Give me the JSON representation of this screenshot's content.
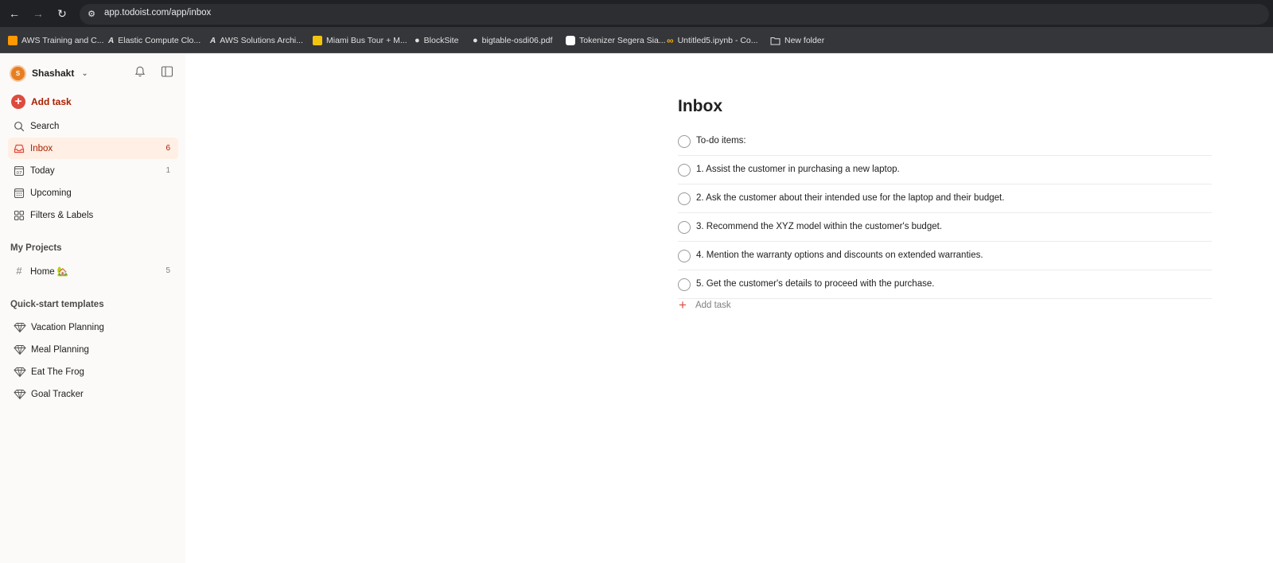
{
  "browser": {
    "url": "app.todoist.com/app/inbox",
    "bookmarks": [
      {
        "label": "AWS Training and C...",
        "icon": "aws-cube-icon",
        "color": "#ff9900"
      },
      {
        "label": "Elastic Compute Clo...",
        "icon": "ar-logo-icon",
        "color": "#e0e0e0"
      },
      {
        "label": "AWS Solutions Archi...",
        "icon": "ar-logo-icon",
        "color": "#e0e0e0"
      },
      {
        "label": "Miami Bus Tour + M...",
        "icon": "bus-tour-icon",
        "color": "#f1c40f"
      },
      {
        "label": "BlockSite",
        "icon": "globe-icon",
        "color": "#e0e0e0"
      },
      {
        "label": "bigtable-osdi06.pdf",
        "icon": "globe-icon",
        "color": "#e0e0e0"
      },
      {
        "label": "Tokenizer Segera Sia...",
        "icon": "openai-icon",
        "color": "#ffffff"
      },
      {
        "label": "Untitled5.ipynb - Co...",
        "icon": "colab-icon",
        "color": "#f9ab00"
      },
      {
        "label": "New folder",
        "icon": "folder-icon",
        "color": "#e0e0e0"
      }
    ]
  },
  "sidebar": {
    "user": {
      "name": "Shashakt",
      "initial": "S"
    },
    "add_task": "Add task",
    "nav": [
      {
        "label": "Search",
        "count": ""
      },
      {
        "label": "Inbox",
        "count": "6"
      },
      {
        "label": "Today",
        "count": "1"
      },
      {
        "label": "Upcoming",
        "count": ""
      },
      {
        "label": "Filters & Labels",
        "count": ""
      }
    ],
    "projects_header": "My Projects",
    "projects": [
      {
        "label": "Home 🏡",
        "count": "5"
      }
    ],
    "templates_header": "Quick-start templates",
    "templates": [
      {
        "label": "Vacation Planning"
      },
      {
        "label": "Meal Planning"
      },
      {
        "label": "Eat The Frog"
      },
      {
        "label": "Goal Tracker"
      }
    ]
  },
  "main": {
    "title": "Inbox",
    "tasks": [
      {
        "text": "To-do items:"
      },
      {
        "text": "1. Assist the customer in purchasing a new laptop."
      },
      {
        "text": "2. Ask the customer about their intended use for the laptop and their budget."
      },
      {
        "text": "3. Recommend the XYZ model within the customer's budget."
      },
      {
        "text": "4. Mention the warranty options and discounts on extended warranties."
      },
      {
        "text": "5. Get the customer's details to proceed with the purchase."
      }
    ],
    "add_task": "Add task"
  },
  "colors": {
    "accent": "#dc4c3e",
    "accent_text": "#a81f00",
    "active_bg": "#ffefe5",
    "sidebar_bg": "#fcfaf8"
  }
}
